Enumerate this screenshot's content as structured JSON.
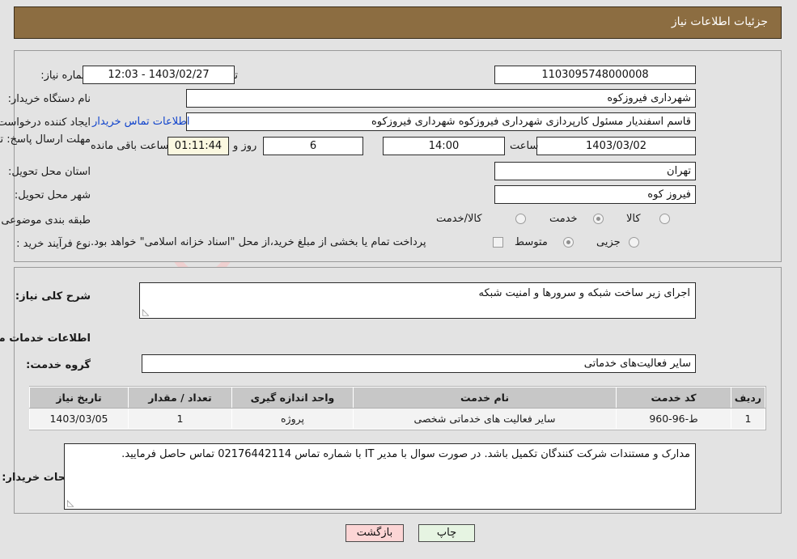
{
  "header": {
    "title": "جزئیات اطلاعات نیاز"
  },
  "top": {
    "need_number_label": "شماره نیاز:",
    "need_number_value": "1103095748000008",
    "announce_label": "تاریخ و ساعت اعلان عمومی:",
    "announce_value": "1403/02/27 - 12:03",
    "buyer_org_label": "نام دستگاه خریدار:",
    "buyer_org_value": "شهرداری فیروزکوه",
    "creator_label": "ایجاد کننده درخواست:",
    "creator_value": "قاسم اسفندیار مسئول کارپردازی شهرداری فیروزکوه شهرداری فیروزکوه",
    "contact_link": "اطلاعات تماس خریدار",
    "deadline_label": "مهلت ارسال پاسخ: تا تاریخ:",
    "deadline_date": "1403/03/02",
    "hour_label": "ساعت",
    "deadline_time": "14:00",
    "days_value": "6",
    "days_label": "روز و",
    "countdown_value": "01:11:44",
    "remaining_label": "ساعت باقی مانده",
    "province_label": "استان محل تحویل:",
    "province_value": "تهران",
    "city_label": "شهر محل تحویل:",
    "city_value": "فیروز کوه",
    "category_label": "طبقه بندی موضوعی:",
    "category_options": [
      {
        "label": "کالا",
        "selected": false
      },
      {
        "label": "خدمت",
        "selected": true
      },
      {
        "label": "کالا/خدمت",
        "selected": false
      }
    ],
    "process_label": "نوع فرآیند خرید :",
    "process_options": [
      {
        "label": "جزیی",
        "selected": false
      },
      {
        "label": "متوسط",
        "selected": true
      }
    ],
    "treasury_checkbox_label": "پرداخت تمام یا بخشی از مبلغ خرید،از محل \"اسناد خزانه اسلامی\" خواهد بود.",
    "treasury_checked": false
  },
  "bottom": {
    "general_desc_label": "شرح کلی نیاز:",
    "general_desc_value": "اجرای زیر ساخت شبکه و سرورها و امنیت شبکه",
    "services_info_heading": "اطلاعات خدمات مورد نیاز",
    "service_group_label": "گروه خدمت:",
    "service_group_value": "سایر فعالیت‌های خدماتی",
    "table": {
      "columns": [
        "ردیف",
        "کد خدمت",
        "نام خدمت",
        "واحد اندازه گیری",
        "تعداد / مقدار",
        "تاریخ نیاز"
      ],
      "rows": [
        [
          "1",
          "ط-96-960",
          "سایر فعالیت های خدماتی شخصی",
          "پروژه",
          "1",
          "1403/03/05"
        ]
      ]
    },
    "buyer_notes_label": "توضیحات خریدار:",
    "buyer_notes_value": "مدارک و مستندات شرکت کنندگان تکمیل باشد. در صورت سوال با مدیر IT با شماره تماس 02176442114 تماس حاصل فرمایید."
  },
  "footer": {
    "back_label": "بازگشت",
    "print_label": "چاپ"
  },
  "watermark": {
    "text": "AriaTender.net"
  },
  "colors": {
    "header_bg": "#8c6d41",
    "page_bg": "#e3e3e3",
    "link": "#1144cc",
    "countdown_bg": "#fbf8e0",
    "back_btn_bg": "#fcd5d5",
    "print_btn_bg": "#e6f4e2",
    "table_header_bg": "#c7c7c7"
  }
}
